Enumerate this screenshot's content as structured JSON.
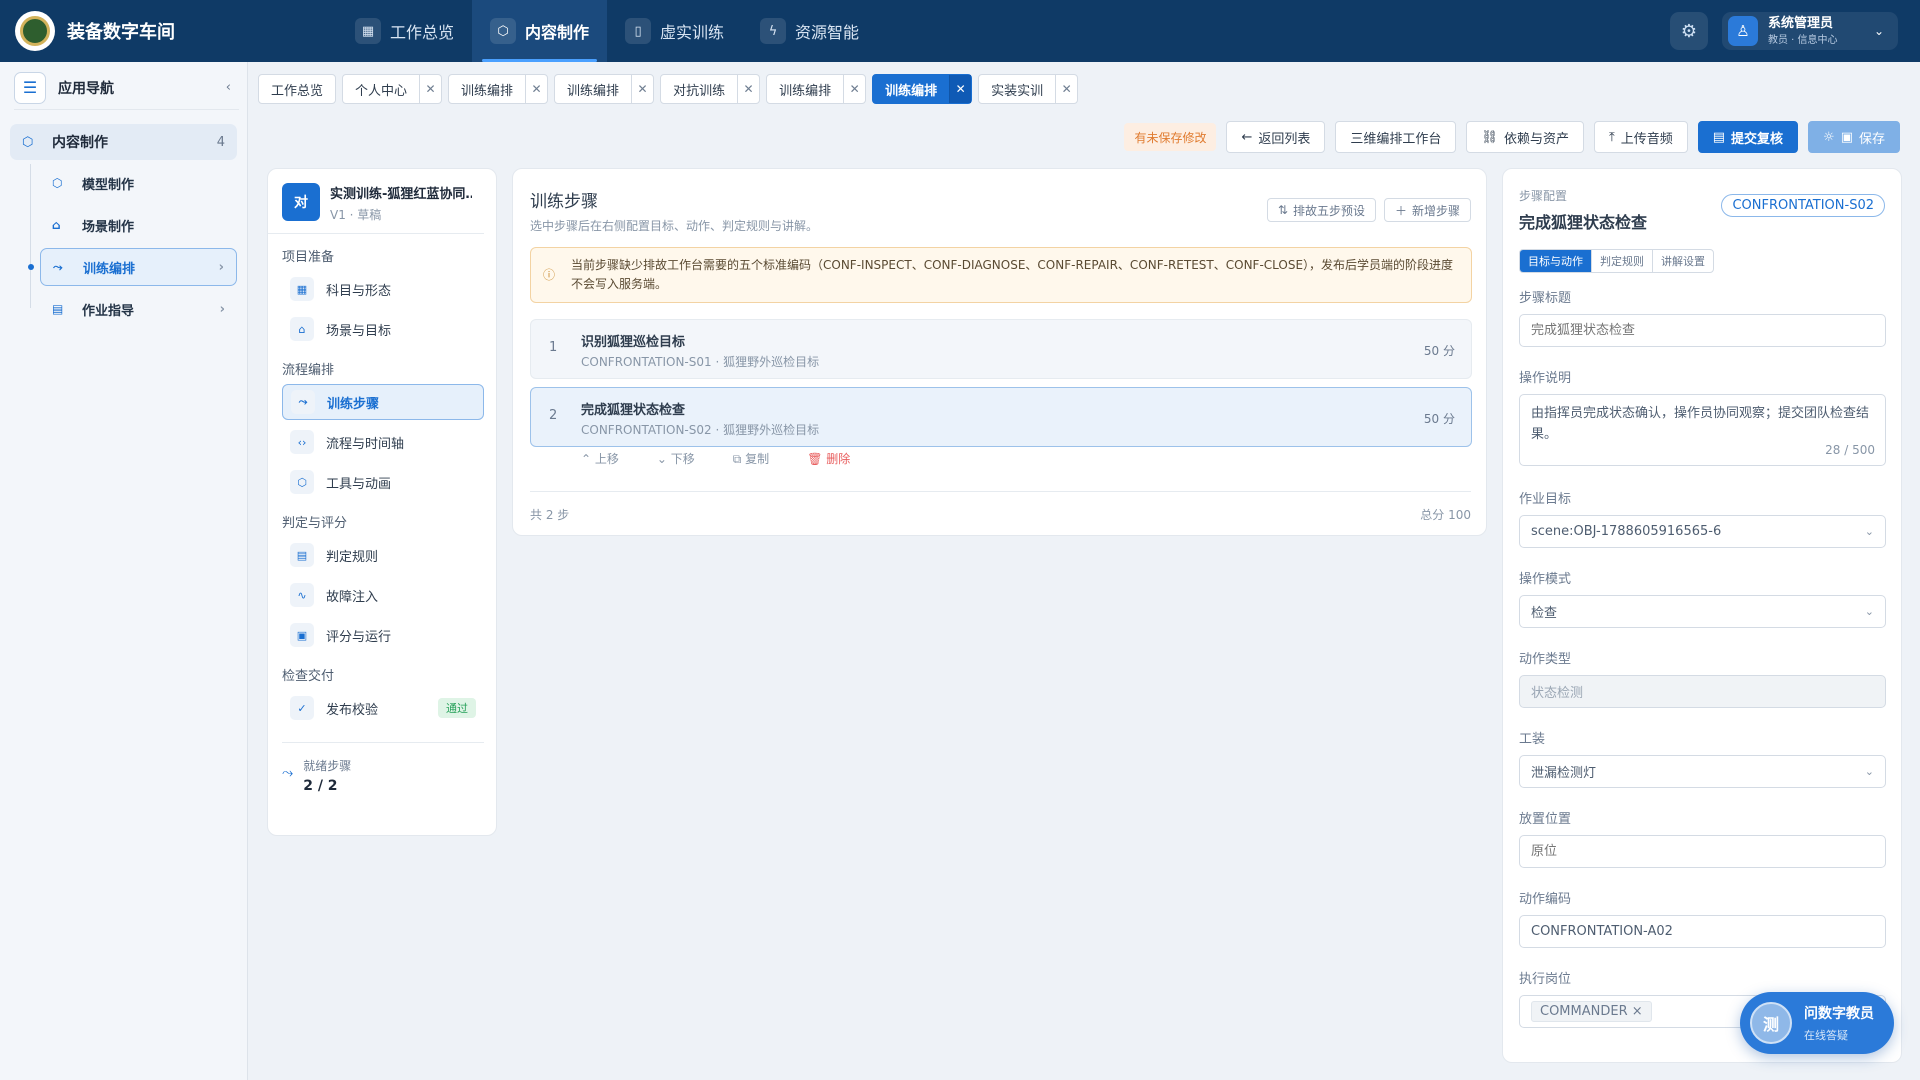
{
  "app": {
    "title": "装备数字车间"
  },
  "topnav": [
    {
      "label": "工作总览",
      "icon": "grid-icon",
      "glyph": "▦"
    },
    {
      "label": "内容制作",
      "icon": "cube-icon",
      "glyph": "⬡"
    },
    {
      "label": "虚实训练",
      "icon": "book-icon",
      "glyph": "▯"
    },
    {
      "label": "资源智能",
      "icon": "sparkle-icon",
      "glyph": "ϟ"
    }
  ],
  "user": {
    "name": "系统管理员",
    "role": "教员 · 信息中心"
  },
  "sidebar": {
    "title": "应用导航",
    "group": {
      "label": "内容制作",
      "count": "4"
    },
    "items": [
      {
        "label": "模型制作",
        "glyph": "⬡"
      },
      {
        "label": "场景制作",
        "glyph": "⌂"
      },
      {
        "label": "训练编排",
        "glyph": "⤳"
      },
      {
        "label": "作业指导",
        "glyph": "▤"
      }
    ]
  },
  "tabs": [
    {
      "label": "工作总览"
    },
    {
      "label": "个人中心"
    },
    {
      "label": "训练编排"
    },
    {
      "label": "训练编排"
    },
    {
      "label": "对抗训练"
    },
    {
      "label": "训练编排"
    },
    {
      "label": "训练编排"
    },
    {
      "label": "实装实训"
    }
  ],
  "actions": {
    "unsaved": "有未保存修改",
    "back": "返回列表",
    "workbench": "三维编排工作台",
    "deps": "依赖与资产",
    "upload": "上传音频",
    "submit": "提交复核",
    "save": "保存"
  },
  "project": {
    "badge": "对",
    "name": "实测训练-狐狸红蓝协同处置",
    "version": "V1 · 草稿",
    "sections": [
      {
        "title": "项目准备",
        "items": [
          {
            "label": "科目与形态",
            "glyph": "▦"
          },
          {
            "label": "场景与目标",
            "glyph": "⌂"
          }
        ]
      },
      {
        "title": "流程编排",
        "items": [
          {
            "label": "训练步骤",
            "glyph": "⤳"
          },
          {
            "label": "流程与时间轴",
            "glyph": "‹›"
          },
          {
            "label": "工具与动画",
            "glyph": "⬡"
          }
        ]
      },
      {
        "title": "判定与评分",
        "items": [
          {
            "label": "判定规则",
            "glyph": "▤"
          },
          {
            "label": "故障注入",
            "glyph": "∿"
          },
          {
            "label": "评分与运行",
            "glyph": "▣"
          }
        ]
      },
      {
        "title": "检查交付",
        "items": [
          {
            "label": "发布校验",
            "glyph": "✓",
            "badge": "通过"
          }
        ]
      }
    ],
    "footer": {
      "label": "就绪步骤",
      "value": "2 / 2"
    }
  },
  "steps_panel": {
    "title": "训练步骤",
    "subtitle": "选中步骤后在右侧配置目标、动作、判定规则与讲解。",
    "btn_preset": "排故五步预设",
    "btn_add": "新增步骤",
    "warning": "当前步骤缺少排故工作台需要的五个标准编码（CONF-INSPECT、CONF-DIAGNOSE、CONF-REPAIR、CONF-RETEST、CONF-CLOSE），发布后学员端的阶段进度不会写入服务端。",
    "steps": [
      {
        "no": "1",
        "name": "识别狐狸巡检目标",
        "desc": "CONFRONTATION-S01 · 狐狸野外巡检目标",
        "score": "50 分"
      },
      {
        "no": "2",
        "name": "完成狐狸状态检查",
        "desc": "CONFRONTATION-S02 · 狐狸野外巡检目标",
        "score": "50 分"
      }
    ],
    "ops": {
      "up": "上移",
      "down": "下移",
      "copy": "复制",
      "delete": "删除"
    },
    "footer_count": "共 2 步",
    "footer_total": "总分 100"
  },
  "config": {
    "label": "步骤配置",
    "title": "完成狐狸状态检查",
    "code": "CONFRONTATION-S02",
    "tabs": [
      "目标与动作",
      "判定规则",
      "讲解设置"
    ],
    "fields": {
      "step_title": {
        "label": "步骤标题",
        "placeholder": "完成狐狸状态检查"
      },
      "desc": {
        "label": "操作说明",
        "value": "由指挥员完成状态确认，操作员协同观察；提交团队检查结果。",
        "count": "28 / 500"
      },
      "target": {
        "label": "作业目标",
        "value": "scene:OBJ-1788605916565-6"
      },
      "mode": {
        "label": "操作模式",
        "value": "检查"
      },
      "action_type": {
        "label": "动作类型",
        "value": "状态检测"
      },
      "tool": {
        "label": "工装",
        "value": "泄漏检测灯"
      },
      "position": {
        "label": "放置位置",
        "placeholder": "原位"
      },
      "action_code": {
        "label": "动作编码",
        "value": "CONFRONTATION-A02"
      },
      "post": {
        "label": "执行岗位",
        "chip": "COMMANDER"
      }
    }
  },
  "assistant": {
    "avatar": "测",
    "name": "问数字教员",
    "sub": "在线答疑"
  }
}
